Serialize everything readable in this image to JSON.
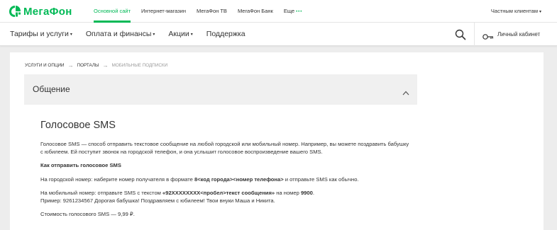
{
  "brand": {
    "name": "МегаФон",
    "color": "#00b956"
  },
  "topbar": {
    "links": [
      "Основной сайт",
      "Интернет-магазин",
      "МегаФон ТВ",
      "МегаФон Банк",
      "Еще"
    ],
    "more_dots": "•••",
    "segment": "Частным клиентам"
  },
  "nav": {
    "items": [
      {
        "label": "Тарифы и услуги",
        "has_caret": true
      },
      {
        "label": "Оплата и финансы",
        "has_caret": true
      },
      {
        "label": "Акции",
        "has_caret": true
      },
      {
        "label": "Поддержка",
        "has_caret": false
      }
    ],
    "caret": "▾",
    "search_icon": "search-icon",
    "cabinet_icon": "key-icon",
    "cabinet_label": "Личный кабинет"
  },
  "breadcrumb": {
    "items": [
      "УСЛУГИ И ОПЦИИ",
      "ПОРТАЛЫ",
      "МОБИЛЬНЫЕ ПОДПИСКИ"
    ],
    "separator": "→"
  },
  "accordion": {
    "title": "Общение",
    "expanded": true
  },
  "article": {
    "title": "Голосовое SMS",
    "intro": "Голосовое SMS — способ отправить текстовое сообщение на любой городской или мобильный номер. Например, вы можете поздравить бабушку с юбилеем. Ей поступит звонок на городской телефон, и она услышит голосовое воспроизведение вашего SMS.",
    "howto_heading": "Как отправить голосовое SMS",
    "landline": {
      "prefix": "На городской номер: наберите номер получателя в формате ",
      "format": "8<код города><номер телефона>",
      "suffix": " и отправьте SMS как обычно."
    },
    "mobile": {
      "prefix": "На мобильный номер: отправьте SMS с текстом ",
      "format": "«92XXXXXXXX<пробел>текст сообщения»",
      "middle": " на номер ",
      "number": "9900",
      "end": ".",
      "example": "Пример: 9261234567 Дорогая бабушка! Поздравляем с юбилеем! Твои внуки Маша и Никита."
    },
    "price": "Стоимость голосового SMS — 9,99 ₽."
  }
}
